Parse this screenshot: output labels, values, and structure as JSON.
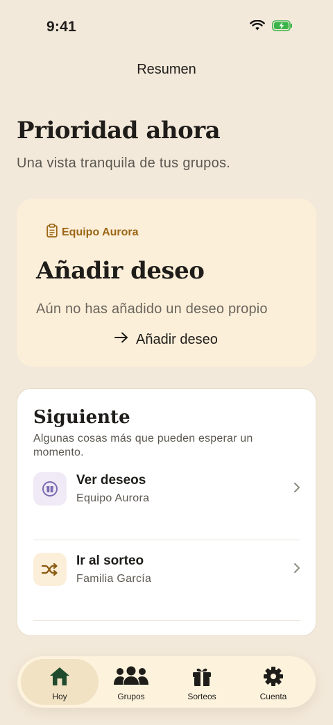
{
  "status_bar": {
    "time": "9:41"
  },
  "nav": {
    "title": "Resumen"
  },
  "hero": {
    "title": "Prioridad ahora",
    "subtitle": "Una vista tranquila de tus grupos."
  },
  "priority_card": {
    "tag": "Equipo Aurora",
    "title": "Añadir deseo",
    "description": "Aún no has añadido un deseo propio",
    "action": "Añadir deseo"
  },
  "next": {
    "title": "Siguiente",
    "subtitle": "Algunas cosas más que pueden esperar un momento.",
    "items": [
      {
        "title": "Ver deseos",
        "subtitle": "Equipo Aurora",
        "icon": "gift-circle-icon"
      },
      {
        "title": "Ir al sorteo",
        "subtitle": "Familia García",
        "icon": "shuffle-icon"
      }
    ]
  },
  "tabs": [
    {
      "label": "Hoy",
      "icon": "home-icon",
      "active": true
    },
    {
      "label": "Grupos",
      "icon": "users-icon"
    },
    {
      "label": "Sorteos",
      "icon": "gift-icon"
    },
    {
      "label": "Cuenta",
      "icon": "gear-icon"
    }
  ],
  "colors": {
    "background": "#f3e9da",
    "accent_gold": "#9a6516",
    "active_tab": "#1f4a2b",
    "lavender": "#7b6ab0"
  }
}
